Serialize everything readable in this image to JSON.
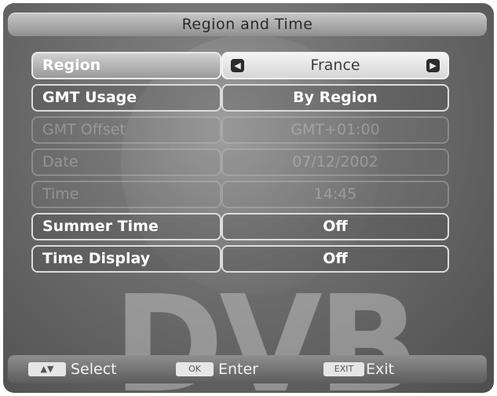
{
  "title": "Region and Time",
  "menu": [
    {
      "label": "Region",
      "value": "France",
      "state": "selected",
      "arrow_left_icon": "chevron-left-icon",
      "arrow_right_icon": "chevron-right-icon"
    },
    {
      "label": "GMT Usage",
      "value": "By Region",
      "state": "normal"
    },
    {
      "label": "GMT Offset",
      "value": "GMT+01:00",
      "state": "disabled"
    },
    {
      "label": "Date",
      "value": "07/12/2002",
      "state": "disabled"
    },
    {
      "label": "Time",
      "value": "14:45",
      "state": "disabled"
    },
    {
      "label": "Summer Time",
      "value": "Off",
      "state": "normal"
    },
    {
      "label": "Time Display",
      "value": "Off",
      "state": "normal"
    }
  ],
  "watermark": "DVB",
  "footer": {
    "select": {
      "key_icon": "up-down-arrow-icon",
      "label": "Select"
    },
    "enter": {
      "key": "OK",
      "label": "Enter"
    },
    "exit": {
      "key": "EXIT",
      "label": "Exit"
    }
  }
}
